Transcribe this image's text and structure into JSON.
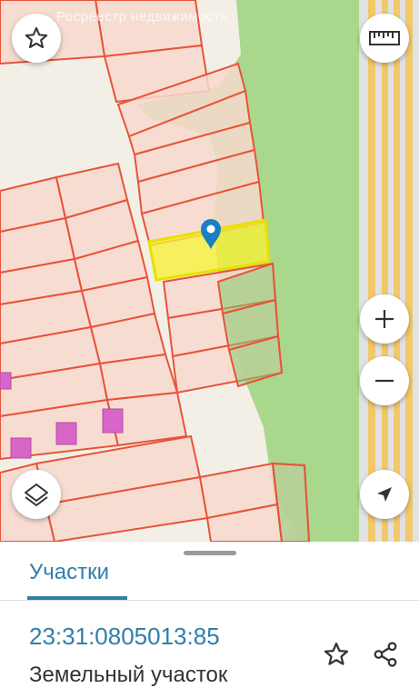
{
  "map": {
    "watermark": "Росреестр недвижимость",
    "buttons": {
      "favorite": "star-icon",
      "ruler": "ruler-icon",
      "zoom_in": "plus-icon",
      "zoom_out": "minus-icon",
      "layers": "layers-icon",
      "locate": "navigation-arrow-icon"
    },
    "colors": {
      "parcel_fill": "#f7d9cc",
      "parcel_border": "#e8533a",
      "forest": "#a8d88a",
      "selected_fill": "#f5f03a",
      "selected_border": "#e8e000",
      "pin": "#1a7fc0",
      "building": "#d865c8"
    }
  },
  "sheet": {
    "tab_label": "Участки",
    "cadastral_number": "23:31:0805013:85",
    "parcel_type": "Земельный участок",
    "accent_color": "#2f7fa8"
  }
}
